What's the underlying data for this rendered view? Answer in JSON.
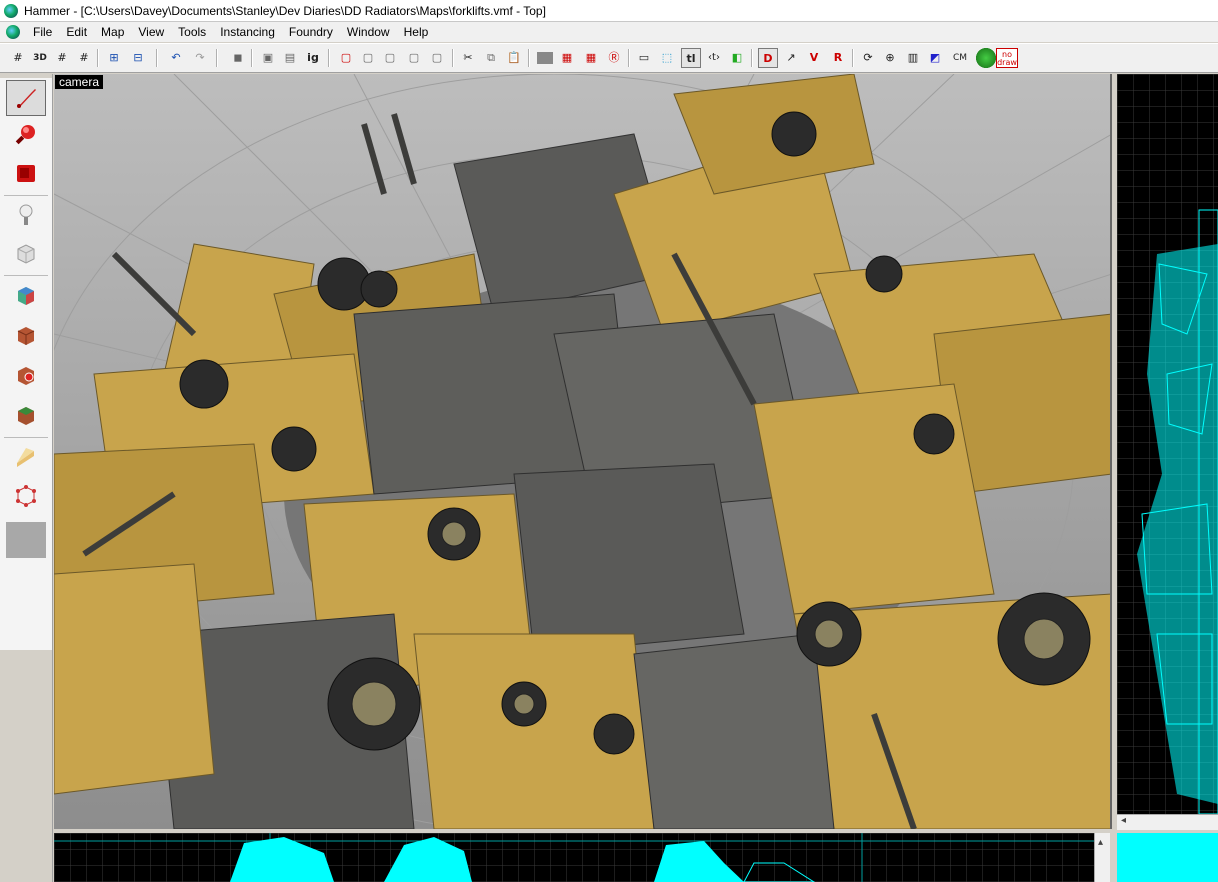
{
  "window": {
    "title": "Hammer - [C:\\Users\\Davey\\Documents\\Stanley\\Dev Diaries\\DD Radiators\\Maps\\forklifts.vmf - Top]"
  },
  "menu": [
    "File",
    "Edit",
    "Map",
    "View",
    "Tools",
    "Instancing",
    "Foundry",
    "Window",
    "Help"
  ],
  "toolbar": {
    "text_buttons": {
      "grid3d": "3D",
      "ig": "ig",
      "tl": "tl",
      "cm": "CM",
      "nodraw": "no draw"
    }
  },
  "left_tools": [
    {
      "name": "selection-tool",
      "icon": "arrow-pointer-icon",
      "selected": true
    },
    {
      "name": "magnify-tool",
      "icon": "magnifier-icon",
      "selected": false
    },
    {
      "name": "camera-tool",
      "icon": "camera-icon",
      "selected": false
    },
    {
      "name": "entity-tool",
      "icon": "light-entity-icon",
      "selected": false
    },
    {
      "name": "block-tool",
      "icon": "cube-icon",
      "selected": false
    },
    {
      "name": "texture-application-tool",
      "icon": "texture-cube-icon",
      "selected": false
    },
    {
      "name": "apply-current-texture-tool",
      "icon": "brick-cube-icon",
      "selected": false
    },
    {
      "name": "decal-tool",
      "icon": "decal-cube-icon",
      "selected": false
    },
    {
      "name": "overlay-tool",
      "icon": "overlay-cube-icon",
      "selected": false
    },
    {
      "name": "clipping-tool",
      "icon": "clip-icon",
      "selected": false
    },
    {
      "name": "vertex-tool",
      "icon": "vertex-manipulation-icon",
      "selected": false
    }
  ],
  "viewports": {
    "camera_label": "camera"
  },
  "colors": {
    "wireframe": "#00ffff",
    "forklift_yellow": "#c8a44c",
    "grid_2d": "#3a3a3a"
  }
}
